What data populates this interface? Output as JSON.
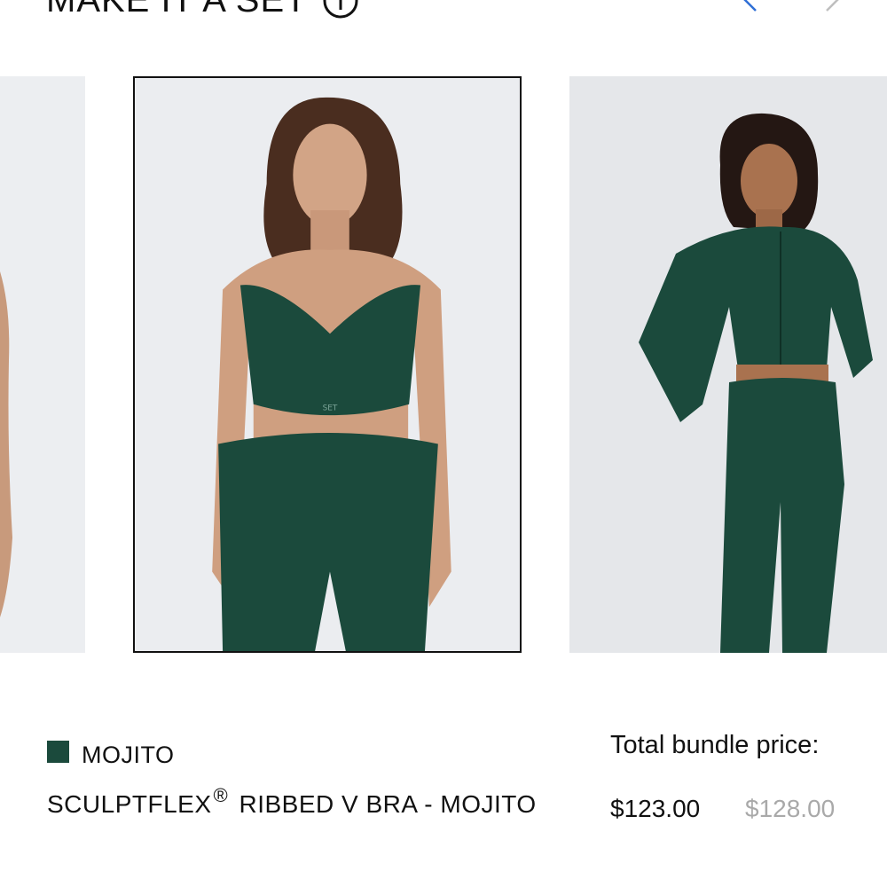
{
  "header": {
    "title": "MAKE IT A SET",
    "info_icon": "info-circle-icon",
    "prev_icon": "chevron-left-icon",
    "next_icon": "chevron-right-icon"
  },
  "carousel": {
    "cards": [
      {
        "position": "left",
        "image": "product-photo-partial"
      },
      {
        "position": "center",
        "image": "model-in-v-bra-and-shorts",
        "selected": true
      },
      {
        "position": "right",
        "image": "model-in-zip-top-and-leggings"
      }
    ]
  },
  "product": {
    "color_name": "MOJITO",
    "color_swatch": "#1b4a3c",
    "name_prefix": "SCULPTFLEX",
    "name_reg": "®",
    "name_suffix": " RIBBED V BRA - MOJITO"
  },
  "bundle": {
    "label": "Total bundle price:",
    "price": "$123.00",
    "original_price": "$128.00"
  },
  "colors": {
    "garment": "#1b4a3c",
    "text": "#111111",
    "muted_price": "#a9a9a9",
    "nav_arrow_active": "#2f6fd6",
    "nav_arrow_disabled": "#bfbfbf"
  }
}
